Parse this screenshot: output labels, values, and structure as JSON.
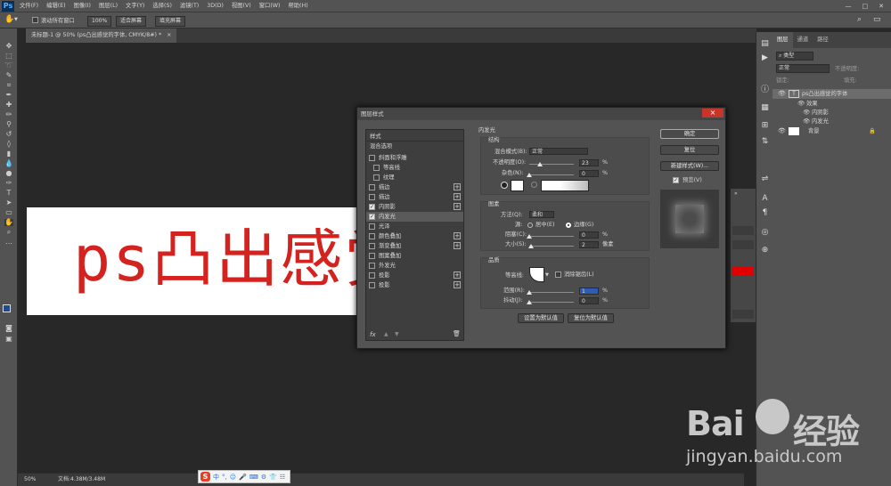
{
  "app": {
    "logo": "Ps",
    "menu": [
      "文件(F)",
      "编辑(E)",
      "图像(I)",
      "图层(L)",
      "文字(Y)",
      "选择(S)",
      "滤镜(T)",
      "3D(D)",
      "视图(V)",
      "窗口(W)",
      "帮助(H)"
    ]
  },
  "options": {
    "scroll_all": "滚动所有窗口",
    "zoom": "100%",
    "fit_screen": "适合屏幕",
    "fill_screen": "填充屏幕"
  },
  "doc_tab": {
    "title": "未标题-1 @ 50% (ps凸出感觉的字体, CMYK/8#) *",
    "close": "×"
  },
  "canvas_text": "ps凸出感觉",
  "status": {
    "zoom": "50%",
    "doc": "文档:4.38M/3.48M"
  },
  "ime": {
    "logo": "S",
    "icons": [
      "中",
      "°,",
      "☺",
      "🎤",
      "⌨",
      "⚙",
      "👕",
      "☷"
    ]
  },
  "layers_panel": {
    "tabs": [
      "图层",
      "通道",
      "路径"
    ],
    "kind_placeholder": "类型",
    "blend": "正常",
    "opacity_label": "不透明度:",
    "lock_label": "锁定:",
    "fill_label": "填充:",
    "layer1": "ps凸出感觉的字体",
    "effects": "效果",
    "effect1": "内阴影",
    "effect2": "内发光",
    "background": "背景"
  },
  "dialog": {
    "title": "图层样式",
    "close": "×",
    "styles_header": "样式",
    "blend_options": "混合选项",
    "items": [
      {
        "label": "斜面和浮雕",
        "checked": false,
        "plus": false,
        "indent": false
      },
      {
        "label": "等高线",
        "checked": false,
        "plus": false,
        "indent": true
      },
      {
        "label": "纹理",
        "checked": false,
        "plus": false,
        "indent": true
      },
      {
        "label": "描边",
        "checked": false,
        "plus": true,
        "indent": false
      },
      {
        "label": "描边",
        "checked": false,
        "plus": true,
        "indent": false
      },
      {
        "label": "内阴影",
        "checked": true,
        "plus": true,
        "indent": false
      },
      {
        "label": "内发光",
        "checked": true,
        "plus": false,
        "indent": false
      },
      {
        "label": "光泽",
        "checked": false,
        "plus": false,
        "indent": false
      },
      {
        "label": "颜色叠加",
        "checked": false,
        "plus": true,
        "indent": false
      },
      {
        "label": "渐变叠加",
        "checked": false,
        "plus": true,
        "indent": false
      },
      {
        "label": "图案叠加",
        "checked": false,
        "plus": false,
        "indent": false
      },
      {
        "label": "外发光",
        "checked": false,
        "plus": false,
        "indent": false
      },
      {
        "label": "投影",
        "checked": false,
        "plus": true,
        "indent": false
      },
      {
        "label": "投影",
        "checked": false,
        "plus": true,
        "indent": false
      }
    ],
    "fx": "fx",
    "section_title": "内发光",
    "structure": {
      "title": "结构",
      "blend_label": "混合模式(B):",
      "blend_value": "正常",
      "opacity_label": "不透明度(O):",
      "opacity_value": "23",
      "noise_label": "杂色(N):",
      "noise_value": "0",
      "pct": "%"
    },
    "elements": {
      "title": "图素",
      "method_label": "方法(Q):",
      "method_value": "柔和",
      "source_label": "源:",
      "center": "居中(E)",
      "edge": "边缘(G)",
      "choke_label": "阻塞(C):",
      "choke_value": "0",
      "size_label": "大小(S):",
      "size_value": "2",
      "px": "像素"
    },
    "quality": {
      "title": "品质",
      "contour_label": "等高线:",
      "antialias": "消除锯齿(L)",
      "range_label": "范围(R):",
      "range_value": "1",
      "jitter_label": "抖动(J):",
      "jitter_value": "0"
    },
    "set_default": "设置为默认值",
    "reset_default": "复位为默认值",
    "ok": "确定",
    "reset": "复位",
    "new_style": "新建样式(W)...",
    "preview": "预览(V)"
  },
  "watermark": {
    "brand": "Bai",
    "brand2": "经验",
    "url": "jingyan.baidu.com"
  }
}
